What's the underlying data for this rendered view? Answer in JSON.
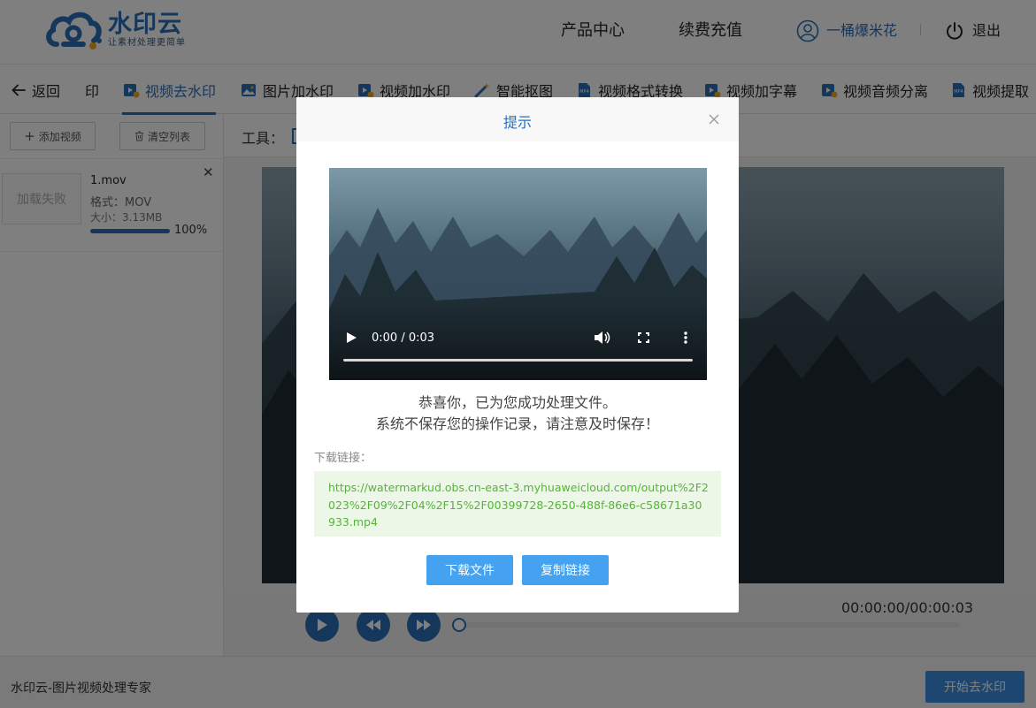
{
  "header": {
    "logo_name": "水印云",
    "logo_slogan": "让素材处理更简单",
    "nav_product": "产品中心",
    "nav_renew": "续费充值",
    "user_name": "一桶爆米花",
    "logout": "退出"
  },
  "tabs": {
    "back": "返回",
    "partial": "印",
    "items": [
      "视频去水印",
      "图片加水印",
      "视频加水印",
      "智能抠图",
      "视频格式转换",
      "视频加字幕",
      "视频音频分离",
      "视频提取"
    ],
    "active": "视频去水印"
  },
  "left": {
    "add_video": "添加视频",
    "clear_list": "清空列表",
    "file": {
      "thumb_status": "加载失败",
      "name": "1.mov",
      "format": "格式：MOV",
      "size": "大小：3.13MB",
      "progress_text": "100%",
      "progress": 1.0
    }
  },
  "main": {
    "tools_label": "工具：",
    "timecode": "00:00:00/00:00:03"
  },
  "footer": {
    "title": "水印云-图片视频处理专家",
    "start": "开始去水印"
  },
  "modal": {
    "title": "提示",
    "video_time": "0:00 / 0:03",
    "message_1": "恭喜你，已为您成功处理文件。",
    "message_2": "系统不保存您的操作记录，请注意及时保存！",
    "download_label": "下载链接：",
    "url": "https://watermarkud.obs.cn-east-3.myhuaweicloud.com/output%2F2023%2F09%2F04%2F15%2F00399728-2650-488f-86e6-c58671a30933.mp4",
    "download_button": "下载文件",
    "copy_button": "复制链接"
  },
  "colors": {
    "brand": "#2a6fb9",
    "modal_button": "#45a2f0",
    "url_text": "#56b33a",
    "url_bg": "#edf7e8"
  }
}
